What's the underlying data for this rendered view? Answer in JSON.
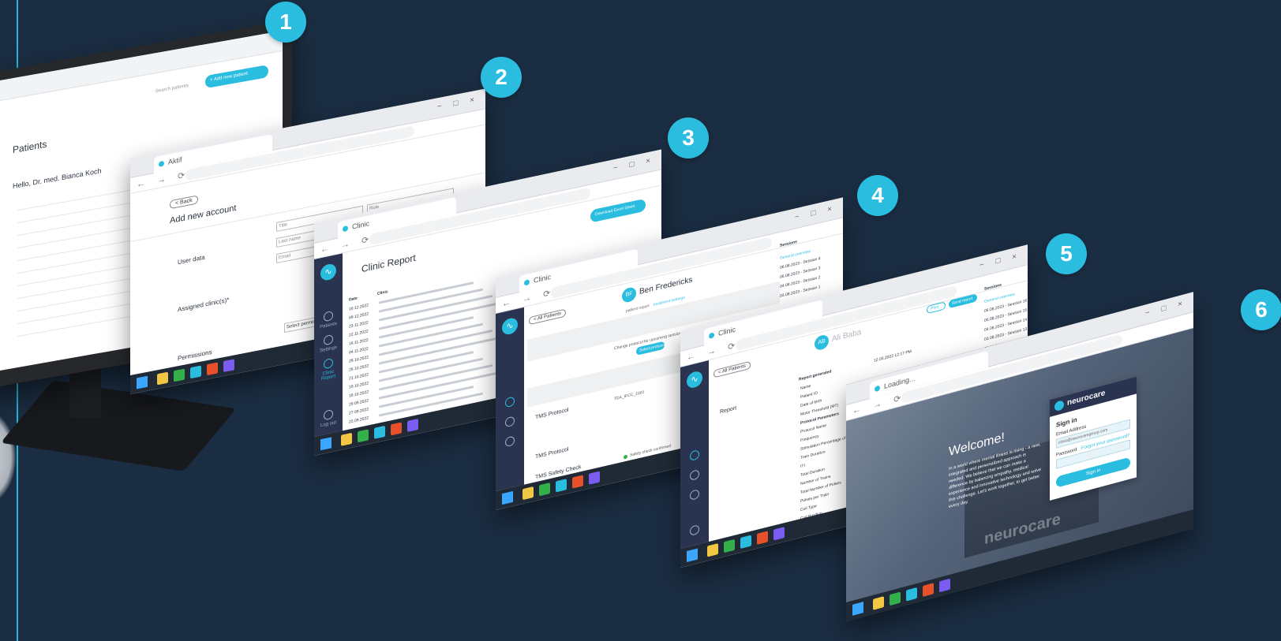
{
  "badges": [
    "1",
    "2",
    "3",
    "4",
    "5",
    "6"
  ],
  "screen1": {
    "title": "Patients",
    "greeting": "Hello, Dr. med. Bianca Koch",
    "search_placeholder": "Search patients",
    "add_button": "+ Add new patient"
  },
  "screen2": {
    "tab": "Aktif",
    "back": "< Back",
    "title": "Add new account",
    "section_user_data": "User data",
    "section_clinics": "Assigned clinic(s)*",
    "section_permissions": "Permissions",
    "field_title": "Title",
    "field_role": "Role",
    "field_last_name": "Last name",
    "field_email": "Email",
    "select_permission": "Select permissions for Tesla"
  },
  "screen3": {
    "tab": "Clinic",
    "title": "Clinic Report",
    "download_button": "Download Excel Sheet",
    "col_date": "Date",
    "col_clinic": "Clinic",
    "dates": [
      "16.12.2022",
      "09.12.2022",
      "23.11.2022",
      "22.11.2022",
      "16.11.2022",
      "04.11.2022",
      "28.10.2022",
      "26.10.2022",
      "21.10.2022",
      "19.10.2022",
      "18.10.2022",
      "29.09.2022",
      "27.09.2022",
      "22.09.2022"
    ],
    "nav": [
      "Patients",
      "Settings",
      "Clinic Report",
      "Log out"
    ]
  },
  "screen4": {
    "tab": "Clinic",
    "patient_initials": "BF",
    "patient_name": "Ben Fredericks",
    "back": "< All Patients",
    "tab_patient_report": "patient report",
    "tab_treatment_settings": "treatment settings",
    "protocol_prompt": "Change protocol for upcoming sessions",
    "select_protocol": "Select protocol",
    "tms_protocol": "TMS Protocol",
    "tms_protocol_2": "TMS Protocol",
    "safety_check": "TMS Safety Check",
    "protocol_code": "TDA_IFCC_1001",
    "safety_status": "Safety check confirmed",
    "sessions_header": "Sessions",
    "general_overview": "General overview",
    "session_rows": [
      "06.08.2023 - Session 4",
      "05.08.2023 - Session 3",
      "04.08.2023 - Session 2",
      "03.08.2023 - Session 1"
    ]
  },
  "screen5": {
    "tab": "Clinic",
    "patient_initials": "AB",
    "patient_name": "Ali Baba",
    "back": "< All Patients",
    "section_report": "Report",
    "report_generated": "Report generated",
    "report_date": "12.03.2022 12:17 PM",
    "fields": [
      "Name",
      "Patient ID",
      "Date of birth",
      "Motor Threshold (MT)",
      "Protocol Parameters",
      "Protocol Name",
      "Frequency",
      "Stimulation Percentage of MT",
      "Train Duration",
      "ITI",
      "Total Duration",
      "Number of Trains",
      "Total Number of Pulses",
      "Pulses per Train",
      "Coil Type",
      "Coil Position",
      "Total Duration",
      "Session Overview"
    ],
    "print_button": "Print",
    "export_button": "Send report",
    "sessions_header": "Sessions",
    "general_overview": "General overview",
    "session_rows": [
      "06.08.2023 - Session 16",
      "05.08.2023 - Session 15",
      "04.08.2023 - Session 14",
      "03.08.2023 - Session 13",
      "02.08.2023 - Session 12"
    ]
  },
  "screen6": {
    "tab": "Loading...",
    "welcome": "Welcome!",
    "body": "In a world where mental illness is rising - a new, integrated and personalized approach is needed. We believe that we can make a difference by balancing empathy, medical experience and innovative technology and solve this challenge. Let's work together, to get better every day.",
    "brand": "neurocare",
    "signin_title": "Sign in",
    "email_label": "Email Address",
    "email_value": "clinic@neurocaregroup.com",
    "password_label": "Password",
    "forgot": "Forgot your password?",
    "signin_button": "Sign in"
  },
  "colors": {
    "background": "#1b2d42",
    "accent": "#2bbde0",
    "sidebar": "#2a3350"
  }
}
